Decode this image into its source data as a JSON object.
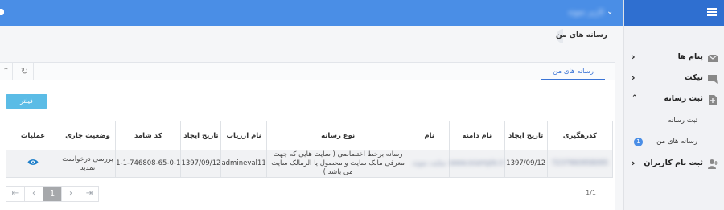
{
  "header": {
    "user_name": "کاربر نمونه"
  },
  "breadcrumb": "رسانه های من",
  "sidebar": {
    "items": [
      {
        "label": "پیام ها",
        "icon": "envelope-icon"
      },
      {
        "label": "تیکت",
        "icon": "chat-icon"
      },
      {
        "label": "ثبت رسانه",
        "icon": "file-add-icon"
      },
      {
        "label": "ثبت نام کاربران",
        "icon": "user-add-icon"
      }
    ],
    "subitems": [
      {
        "label": "ثبت رسانه"
      },
      {
        "label": "رسانه های من",
        "badge": "1"
      }
    ]
  },
  "tabs": {
    "active": "رسانه های من"
  },
  "toolbar": {
    "filter_label": "فیلتر"
  },
  "table": {
    "headers": [
      "کدرهگیری",
      "تاریخ ایجاد",
      "نام دامنه",
      "نام",
      "نوع رسانه",
      "نام ارزیاب",
      "تاریخ ایجاد",
      "کد شامد",
      "وضعیت جاری",
      "عملیات"
    ],
    "row": {
      "tracking_code": "7237960958095",
      "created": "1397/09/12",
      "domain": "www.example.ir",
      "name": "سایت نمونه",
      "media_type": "رسانه برخط اختصاصی ( سایت هایی که جهت معرفی مالک سایت و محصول یا الرمالک سایت می باشد )",
      "evaluator": "admineval11",
      "created2": "1397/09/12",
      "shamed_code": "1-1-746808-65-0-1",
      "status": "بررسی درخواست تمدید"
    }
  },
  "pagination": {
    "current": "1",
    "info": "1/1"
  }
}
